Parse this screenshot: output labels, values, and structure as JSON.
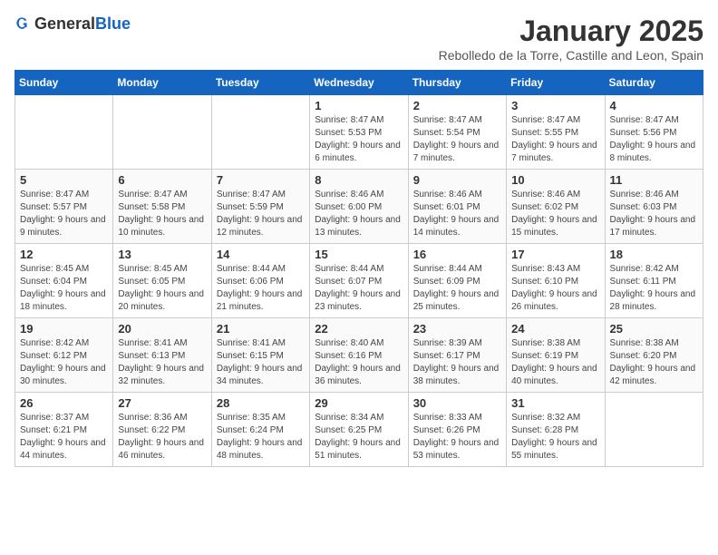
{
  "logo": {
    "general": "General",
    "blue": "Blue"
  },
  "title": "January 2025",
  "subtitle": "Rebolledo de la Torre, Castille and Leon, Spain",
  "weekdays": [
    "Sunday",
    "Monday",
    "Tuesday",
    "Wednesday",
    "Thursday",
    "Friday",
    "Saturday"
  ],
  "weeks": [
    [
      {
        "day": "",
        "text": ""
      },
      {
        "day": "",
        "text": ""
      },
      {
        "day": "",
        "text": ""
      },
      {
        "day": "1",
        "text": "Sunrise: 8:47 AM\nSunset: 5:53 PM\nDaylight: 9 hours and 6 minutes."
      },
      {
        "day": "2",
        "text": "Sunrise: 8:47 AM\nSunset: 5:54 PM\nDaylight: 9 hours and 7 minutes."
      },
      {
        "day": "3",
        "text": "Sunrise: 8:47 AM\nSunset: 5:55 PM\nDaylight: 9 hours and 7 minutes."
      },
      {
        "day": "4",
        "text": "Sunrise: 8:47 AM\nSunset: 5:56 PM\nDaylight: 9 hours and 8 minutes."
      }
    ],
    [
      {
        "day": "5",
        "text": "Sunrise: 8:47 AM\nSunset: 5:57 PM\nDaylight: 9 hours and 9 minutes."
      },
      {
        "day": "6",
        "text": "Sunrise: 8:47 AM\nSunset: 5:58 PM\nDaylight: 9 hours and 10 minutes."
      },
      {
        "day": "7",
        "text": "Sunrise: 8:47 AM\nSunset: 5:59 PM\nDaylight: 9 hours and 12 minutes."
      },
      {
        "day": "8",
        "text": "Sunrise: 8:46 AM\nSunset: 6:00 PM\nDaylight: 9 hours and 13 minutes."
      },
      {
        "day": "9",
        "text": "Sunrise: 8:46 AM\nSunset: 6:01 PM\nDaylight: 9 hours and 14 minutes."
      },
      {
        "day": "10",
        "text": "Sunrise: 8:46 AM\nSunset: 6:02 PM\nDaylight: 9 hours and 15 minutes."
      },
      {
        "day": "11",
        "text": "Sunrise: 8:46 AM\nSunset: 6:03 PM\nDaylight: 9 hours and 17 minutes."
      }
    ],
    [
      {
        "day": "12",
        "text": "Sunrise: 8:45 AM\nSunset: 6:04 PM\nDaylight: 9 hours and 18 minutes."
      },
      {
        "day": "13",
        "text": "Sunrise: 8:45 AM\nSunset: 6:05 PM\nDaylight: 9 hours and 20 minutes."
      },
      {
        "day": "14",
        "text": "Sunrise: 8:44 AM\nSunset: 6:06 PM\nDaylight: 9 hours and 21 minutes."
      },
      {
        "day": "15",
        "text": "Sunrise: 8:44 AM\nSunset: 6:07 PM\nDaylight: 9 hours and 23 minutes."
      },
      {
        "day": "16",
        "text": "Sunrise: 8:44 AM\nSunset: 6:09 PM\nDaylight: 9 hours and 25 minutes."
      },
      {
        "day": "17",
        "text": "Sunrise: 8:43 AM\nSunset: 6:10 PM\nDaylight: 9 hours and 26 minutes."
      },
      {
        "day": "18",
        "text": "Sunrise: 8:42 AM\nSunset: 6:11 PM\nDaylight: 9 hours and 28 minutes."
      }
    ],
    [
      {
        "day": "19",
        "text": "Sunrise: 8:42 AM\nSunset: 6:12 PM\nDaylight: 9 hours and 30 minutes."
      },
      {
        "day": "20",
        "text": "Sunrise: 8:41 AM\nSunset: 6:13 PM\nDaylight: 9 hours and 32 minutes."
      },
      {
        "day": "21",
        "text": "Sunrise: 8:41 AM\nSunset: 6:15 PM\nDaylight: 9 hours and 34 minutes."
      },
      {
        "day": "22",
        "text": "Sunrise: 8:40 AM\nSunset: 6:16 PM\nDaylight: 9 hours and 36 minutes."
      },
      {
        "day": "23",
        "text": "Sunrise: 8:39 AM\nSunset: 6:17 PM\nDaylight: 9 hours and 38 minutes."
      },
      {
        "day": "24",
        "text": "Sunrise: 8:38 AM\nSunset: 6:19 PM\nDaylight: 9 hours and 40 minutes."
      },
      {
        "day": "25",
        "text": "Sunrise: 8:38 AM\nSunset: 6:20 PM\nDaylight: 9 hours and 42 minutes."
      }
    ],
    [
      {
        "day": "26",
        "text": "Sunrise: 8:37 AM\nSunset: 6:21 PM\nDaylight: 9 hours and 44 minutes."
      },
      {
        "day": "27",
        "text": "Sunrise: 8:36 AM\nSunset: 6:22 PM\nDaylight: 9 hours and 46 minutes."
      },
      {
        "day": "28",
        "text": "Sunrise: 8:35 AM\nSunset: 6:24 PM\nDaylight: 9 hours and 48 minutes."
      },
      {
        "day": "29",
        "text": "Sunrise: 8:34 AM\nSunset: 6:25 PM\nDaylight: 9 hours and 51 minutes."
      },
      {
        "day": "30",
        "text": "Sunrise: 8:33 AM\nSunset: 6:26 PM\nDaylight: 9 hours and 53 minutes."
      },
      {
        "day": "31",
        "text": "Sunrise: 8:32 AM\nSunset: 6:28 PM\nDaylight: 9 hours and 55 minutes."
      },
      {
        "day": "",
        "text": ""
      }
    ]
  ]
}
